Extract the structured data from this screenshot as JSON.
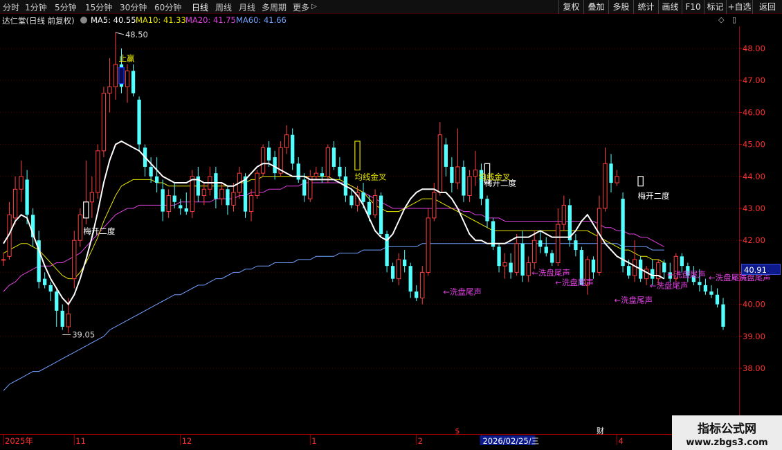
{
  "toolbar": {
    "periods": [
      "分时",
      "1分钟",
      "5分钟",
      "15分钟",
      "30分钟",
      "60分钟",
      "日线",
      "周线",
      "月线",
      "多周期",
      "更多"
    ],
    "active_period": "日线",
    "more_arrow": "▷",
    "buttons": [
      "复权",
      "叠加",
      "多股",
      "统计",
      "画线",
      "F10",
      "标记",
      "+自选",
      "返回"
    ]
  },
  "infobar": {
    "stock": "达仁堂(日线 前复权)",
    "ma5": "MA5: 40.55",
    "ma10": "MA10: 41.33",
    "ma20": "MA20: 41.75",
    "ma60": "MA60: 41.66",
    "ma5_color": "#ffffff",
    "ma10_color": "#e6e600",
    "ma20_color": "#e040e0",
    "ma60_color": "#70a0ff"
  },
  "price_box": "40.91",
  "watermark": {
    "title": "指标公式网",
    "url": "www.zbgs3.com"
  },
  "chart_data": {
    "type": "candlestick",
    "ylim": [
      37.0,
      49.0
    ],
    "yticks": [
      "48.00",
      "47.00",
      "46.00",
      "45.00",
      "44.00",
      "43.00",
      "42.00",
      "41.00",
      "40.00",
      "39.00",
      "38.00"
    ],
    "xlabels": [
      {
        "label": "2025年",
        "i": 0
      },
      {
        "label": "11",
        "i": 12
      },
      {
        "label": "12",
        "i": 30
      },
      {
        "label": "1",
        "i": 52
      },
      {
        "label": "2",
        "i": 70
      },
      {
        "label": "2026/02/25/三",
        "i": 81
      },
      {
        "label": "4",
        "i": 104
      }
    ],
    "markers": [
      {
        "label": "$",
        "i": 77,
        "color": "#ff3030"
      },
      {
        "label": "财",
        "i": 101,
        "color": "#ffffff"
      }
    ],
    "up_color": "#ff4040",
    "down_color": "#54ffff",
    "candles": [
      [
        41.4,
        41.6,
        41.2,
        41.4
      ],
      [
        41.5,
        43.2,
        41.4,
        42.8
      ],
      [
        42.7,
        44.0,
        42.5,
        43.6
      ],
      [
        43.6,
        44.5,
        43.2,
        44.0
      ],
      [
        43.9,
        44.2,
        42.5,
        42.8
      ],
      [
        42.8,
        43.0,
        41.8,
        42.1
      ],
      [
        42.0,
        42.3,
        40.5,
        40.7
      ],
      [
        40.8,
        41.0,
        40.5,
        40.6
      ],
      [
        40.6,
        40.7,
        40.1,
        40.4
      ],
      [
        40.4,
        40.5,
        39.3,
        39.8
      ],
      [
        39.8,
        40.0,
        39.2,
        39.3
      ],
      [
        39.3,
        40.2,
        39.1,
        39.7
      ],
      [
        40.8,
        42.3,
        40.5,
        42.0
      ],
      [
        42.0,
        43.0,
        41.8,
        42.8
      ],
      [
        42.8,
        44.5,
        42.5,
        43.2
      ],
      [
        43.2,
        44.0,
        42.7,
        43.5
      ],
      [
        43.5,
        45.0,
        43.3,
        44.8
      ],
      [
        44.8,
        46.8,
        44.6,
        46.6
      ],
      [
        46.6,
        47.7,
        46.0,
        46.8
      ],
      [
        46.8,
        48.5,
        46.4,
        47.5
      ],
      [
        47.5,
        48.0,
        46.6,
        46.8
      ],
      [
        46.8,
        47.5,
        46.3,
        47.3
      ],
      [
        47.3,
        47.5,
        46.5,
        46.6
      ],
      [
        46.4,
        46.5,
        44.8,
        45.0
      ],
      [
        44.9,
        45.0,
        44.0,
        44.3
      ],
      [
        44.3,
        44.6,
        43.8,
        44.0
      ],
      [
        44.0,
        44.6,
        43.5,
        43.8
      ],
      [
        43.6,
        43.9,
        42.6,
        42.9
      ],
      [
        42.9,
        43.6,
        42.7,
        43.4
      ],
      [
        43.4,
        43.8,
        43.0,
        43.2
      ],
      [
        43.1,
        43.3,
        42.8,
        43.0
      ],
      [
        43.0,
        43.5,
        42.8,
        42.9
      ],
      [
        42.9,
        44.2,
        42.7,
        44.0
      ],
      [
        44.0,
        44.3,
        43.2,
        43.4
      ],
      [
        43.4,
        43.8,
        43.1,
        43.6
      ],
      [
        43.6,
        44.3,
        43.4,
        44.0
      ],
      [
        44.1,
        44.3,
        43.0,
        43.3
      ],
      [
        43.3,
        43.8,
        43.1,
        43.6
      ],
      [
        43.6,
        43.7,
        42.8,
        43.1
      ],
      [
        43.1,
        43.8,
        42.9,
        43.5
      ],
      [
        43.5,
        44.3,
        43.3,
        44.1
      ],
      [
        44.0,
        44.1,
        42.7,
        42.9
      ],
      [
        42.9,
        43.6,
        42.6,
        43.4
      ],
      [
        43.4,
        44.2,
        43.3,
        44.1
      ],
      [
        44.1,
        45.0,
        44.0,
        44.9
      ],
      [
        44.9,
        45.1,
        44.3,
        44.5
      ],
      [
        44.6,
        44.8,
        43.9,
        44.1
      ],
      [
        44.1,
        45.1,
        44.0,
        44.9
      ],
      [
        44.9,
        45.6,
        44.7,
        45.3
      ],
      [
        45.3,
        45.5,
        44.2,
        44.4
      ],
      [
        44.4,
        44.6,
        43.8,
        43.9
      ],
      [
        43.9,
        44.1,
        43.2,
        43.4
      ],
      [
        43.3,
        44.2,
        43.2,
        44.0
      ],
      [
        44.0,
        44.3,
        43.9,
        44.1
      ],
      [
        44.1,
        44.3,
        43.8,
        44.0
      ],
      [
        44.0,
        45.0,
        43.8,
        44.9
      ],
      [
        44.9,
        45.1,
        44.2,
        44.3
      ],
      [
        44.3,
        44.6,
        43.9,
        44.0
      ],
      [
        44.0,
        44.3,
        43.2,
        43.4
      ],
      [
        43.4,
        43.6,
        43.0,
        43.1
      ],
      [
        43.1,
        43.7,
        42.9,
        43.5
      ],
      [
        43.5,
        43.8,
        43.0,
        43.2
      ],
      [
        43.2,
        43.4,
        42.6,
        42.8
      ],
      [
        42.8,
        43.6,
        42.7,
        43.4
      ],
      [
        43.4,
        43.5,
        42.1,
        42.2
      ],
      [
        42.2,
        42.3,
        41.0,
        41.2
      ],
      [
        41.2,
        41.3,
        40.7,
        40.8
      ],
      [
        40.8,
        41.6,
        40.6,
        41.4
      ],
      [
        41.4,
        41.7,
        41.0,
        41.2
      ],
      [
        41.2,
        41.3,
        40.2,
        40.4
      ],
      [
        40.4,
        40.6,
        40.1,
        40.2
      ],
      [
        40.2,
        41.2,
        40.0,
        41.0
      ],
      [
        41.0,
        43.0,
        40.9,
        42.7
      ],
      [
        42.7,
        43.8,
        42.6,
        43.5
      ],
      [
        43.5,
        45.7,
        43.4,
        45.3
      ],
      [
        45.0,
        45.2,
        44.0,
        44.3
      ],
      [
        44.3,
        44.6,
        43.5,
        43.8
      ],
      [
        43.8,
        45.5,
        43.6,
        44.3
      ],
      [
        44.3,
        44.5,
        43.2,
        43.4
      ],
      [
        43.4,
        44.2,
        43.2,
        44.0
      ],
      [
        44.0,
        44.8,
        43.7,
        44.2
      ],
      [
        44.2,
        44.4,
        43.1,
        43.3
      ],
      [
        43.3,
        43.4,
        42.4,
        42.6
      ],
      [
        42.6,
        42.7,
        41.7,
        41.8
      ],
      [
        41.8,
        41.9,
        41.0,
        41.2
      ],
      [
        41.2,
        41.6,
        40.8,
        41.3
      ],
      [
        41.3,
        41.6,
        40.8,
        41.0
      ],
      [
        41.0,
        42.2,
        40.9,
        41.9
      ],
      [
        41.9,
        42.3,
        40.7,
        40.9
      ],
      [
        40.9,
        41.5,
        40.7,
        41.3
      ],
      [
        41.3,
        42.3,
        41.1,
        42.0
      ],
      [
        42.0,
        42.3,
        41.6,
        41.8
      ],
      [
        41.8,
        42.1,
        41.5,
        41.6
      ],
      [
        41.6,
        41.7,
        41.2,
        41.3
      ],
      [
        41.3,
        43.0,
        41.2,
        42.5
      ],
      [
        42.5,
        43.4,
        42.3,
        43.1
      ],
      [
        43.1,
        43.3,
        41.8,
        42.0
      ],
      [
        42.0,
        42.2,
        41.5,
        41.7
      ],
      [
        41.7,
        41.8,
        40.6,
        40.6
      ],
      [
        40.6,
        41.5,
        40.3,
        41.4
      ],
      [
        41.4,
        41.5,
        40.8,
        41.0
      ],
      [
        41.0,
        43.4,
        40.9,
        43.0
      ],
      [
        43.0,
        44.9,
        42.9,
        44.4
      ],
      [
        44.4,
        44.7,
        43.5,
        43.8
      ],
      [
        43.8,
        44.2,
        43.7,
        44.0
      ],
      [
        43.3,
        43.5,
        41.0,
        41.2
      ],
      [
        41.2,
        41.4,
        40.8,
        40.9
      ],
      [
        40.9,
        42.0,
        40.7,
        41.4
      ],
      [
        41.4,
        41.5,
        40.7,
        40.8
      ],
      [
        40.8,
        41.2,
        40.6,
        41.1
      ],
      [
        41.1,
        41.4,
        40.6,
        40.8
      ],
      [
        40.8,
        41.4,
        40.6,
        41.3
      ],
      [
        41.3,
        41.4,
        40.8,
        41.0
      ],
      [
        41.0,
        41.3,
        40.7,
        40.8
      ],
      [
        40.8,
        41.6,
        40.7,
        41.5
      ],
      [
        41.5,
        41.6,
        41.0,
        41.2
      ],
      [
        41.2,
        41.3,
        40.7,
        40.9
      ],
      [
        40.9,
        41.2,
        40.6,
        40.7
      ],
      [
        40.7,
        41.1,
        40.4,
        40.6
      ],
      [
        40.6,
        40.8,
        40.3,
        40.4
      ],
      [
        40.4,
        40.6,
        40.2,
        40.3
      ],
      [
        40.3,
        40.5,
        39.9,
        40.0
      ],
      [
        40.0,
        40.2,
        39.2,
        39.3
      ]
    ],
    "ma5": [
      41.9,
      42.2,
      42.6,
      42.8,
      42.7,
      42.2,
      41.7,
      41.2,
      40.8,
      40.5,
      40.2,
      40.0,
      40.3,
      40.8,
      41.4,
      42.1,
      42.9,
      43.8,
      44.5,
      45.0,
      45.1,
      45.0,
      44.9,
      44.8,
      44.6,
      44.4,
      44.2,
      44.0,
      43.9,
      43.8,
      43.8,
      43.8,
      43.9,
      43.9,
      43.8,
      43.8,
      43.8,
      43.8,
      43.7,
      43.7,
      43.8,
      43.9,
      44.1,
      44.3,
      44.4,
      44.4,
      44.3,
      44.2,
      44.1,
      44.0,
      44.0,
      44.0,
      43.9,
      43.9,
      43.9,
      43.9,
      43.9,
      43.8,
      43.7,
      43.6,
      43.4,
      43.1,
      42.7,
      42.3,
      42.1,
      42.0,
      42.2,
      42.6,
      43.0,
      43.3,
      43.5,
      43.6,
      43.6,
      43.6,
      43.5,
      43.5,
      43.3,
      43.0,
      42.6,
      42.2,
      42.0,
      42.0,
      41.9,
      41.9,
      41.9,
      41.9,
      42.0,
      42.1,
      42.1,
      42.1,
      42.2,
      42.3,
      42.2,
      42.1,
      42.1,
      42.1,
      42.1,
      42.3,
      42.6,
      42.8,
      42.5,
      42.2,
      41.9,
      41.7,
      41.5,
      41.4,
      41.3,
      41.2,
      41.1,
      41.0,
      40.9,
      40.9,
      40.8
    ],
    "ma10": [
      41.6,
      41.7,
      41.8,
      41.9,
      41.9,
      41.8,
      41.7,
      41.5,
      41.3,
      41.1,
      40.9,
      40.8,
      40.8,
      41.0,
      41.3,
      41.7,
      42.1,
      42.6,
      43.0,
      43.4,
      43.7,
      43.8,
      43.9,
      43.9,
      43.9,
      43.9,
      43.8,
      43.8,
      43.7,
      43.7,
      43.7,
      43.7,
      43.7,
      43.7,
      43.7,
      43.7,
      43.7,
      43.7,
      43.7,
      43.7,
      43.8,
      43.8,
      43.9,
      43.9,
      44.0,
      44.0,
      44.0,
      44.0,
      44.0,
      44.0,
      44.0,
      44.0,
      44.0,
      44.0,
      44.0,
      44.0,
      43.9,
      43.9,
      43.8,
      43.7,
      43.6,
      43.5,
      43.3,
      43.1,
      43.0,
      42.9,
      42.9,
      42.9,
      43.0,
      43.1,
      43.2,
      43.3,
      43.3,
      43.3,
      43.2,
      43.1,
      43.0,
      42.9,
      42.8,
      42.7,
      42.6,
      42.5,
      42.4,
      42.3,
      42.3,
      42.3,
      42.3,
      42.3,
      42.3,
      42.3,
      42.3,
      42.3,
      42.3,
      42.3,
      42.3,
      42.3,
      42.3,
      42.3,
      42.3,
      42.3,
      42.2,
      42.1,
      42.0,
      41.9,
      41.8,
      41.7,
      41.7,
      41.6,
      41.5,
      41.5,
      41.4,
      41.4,
      41.3
    ],
    "ma20": [
      40.4,
      40.6,
      40.7,
      40.9,
      41.0,
      41.1,
      41.2,
      41.2,
      41.2,
      41.3,
      41.3,
      41.4,
      41.5,
      41.6,
      41.8,
      42.0,
      42.2,
      42.4,
      42.6,
      42.8,
      42.9,
      43.0,
      43.0,
      43.1,
      43.1,
      43.1,
      43.1,
      43.1,
      43.1,
      43.1,
      43.2,
      43.2,
      43.2,
      43.2,
      43.2,
      43.2,
      43.3,
      43.3,
      43.3,
      43.3,
      43.4,
      43.4,
      43.5,
      43.5,
      43.5,
      43.6,
      43.6,
      43.6,
      43.7,
      43.7,
      43.7,
      43.8,
      43.8,
      43.8,
      43.8,
      43.8,
      43.8,
      43.8,
      43.8,
      43.7,
      43.6,
      43.5,
      43.4,
      43.3,
      43.2,
      43.1,
      43.0,
      43.0,
      43.0,
      43.0,
      43.0,
      43.0,
      43.0,
      43.0,
      43.0,
      43.0,
      43.0,
      43.0,
      42.9,
      42.9,
      42.8,
      42.8,
      42.7,
      42.7,
      42.7,
      42.6,
      42.6,
      42.6,
      42.6,
      42.6,
      42.6,
      42.6,
      42.6,
      42.6,
      42.6,
      42.6,
      42.6,
      42.6,
      42.6,
      42.6,
      42.6,
      42.5,
      42.4,
      42.4,
      42.3,
      42.3,
      42.2,
      42.2,
      42.1,
      42.1,
      42.0,
      41.9,
      41.8
    ],
    "ma60": [
      37.3,
      37.5,
      37.6,
      37.7,
      37.8,
      37.9,
      37.9,
      38.0,
      38.1,
      38.2,
      38.3,
      38.4,
      38.5,
      38.6,
      38.7,
      38.8,
      38.9,
      39.0,
      39.2,
      39.3,
      39.4,
      39.5,
      39.6,
      39.7,
      39.8,
      39.9,
      40.0,
      40.1,
      40.2,
      40.3,
      40.3,
      40.4,
      40.5,
      40.6,
      40.6,
      40.7,
      40.8,
      40.8,
      40.9,
      41.0,
      41.0,
      41.1,
      41.1,
      41.2,
      41.2,
      41.2,
      41.3,
      41.3,
      41.3,
      41.3,
      41.4,
      41.4,
      41.4,
      41.5,
      41.5,
      41.5,
      41.5,
      41.6,
      41.6,
      41.6,
      41.6,
      41.7,
      41.7,
      41.7,
      41.7,
      41.8,
      41.8,
      41.8,
      41.8,
      41.8,
      41.8,
      41.9,
      41.9,
      41.9,
      41.9,
      41.9,
      41.9,
      41.9,
      41.9,
      41.9,
      41.9,
      41.9,
      41.9,
      41.9,
      41.9,
      41.9,
      41.9,
      41.9,
      41.9,
      41.9,
      41.9,
      41.9,
      41.9,
      41.9,
      41.9,
      41.9,
      41.9,
      41.9,
      41.9,
      41.9,
      41.9,
      41.9,
      41.9,
      41.9,
      41.9,
      41.8,
      41.8,
      41.8,
      41.8,
      41.8,
      41.7,
      41.7,
      41.7
    ],
    "high_label": {
      "text": "48.50",
      "i": 19,
      "value": 48.5
    },
    "low_label": {
      "text": "39.05",
      "i": 10,
      "value": 39.05
    },
    "annotations": [
      {
        "text": "止赢",
        "i": 20,
        "value": 47.6,
        "color": "#ffff00"
      },
      {
        "text": "梅开二度",
        "i": 14,
        "value": 42.2,
        "color": "#ffffff"
      },
      {
        "text": "梅开二度",
        "i": 108,
        "value": 43.3,
        "color": "#ffffff"
      },
      {
        "text": "梅开二度",
        "i": 82,
        "value": 43.7,
        "color": "#ffffff"
      },
      {
        "text": "均线金叉",
        "i": 60,
        "value": 43.9,
        "color": "#e6e600"
      },
      {
        "text": "均线金叉",
        "i": 81,
        "value": 43.9,
        "color": "#e6e600"
      },
      {
        "text": "←洗盘尾声",
        "i": 75,
        "value": 40.3,
        "color": "#e040e0"
      },
      {
        "text": "←洗盘尾声",
        "i": 90,
        "value": 40.9,
        "color": "#e040e0"
      },
      {
        "text": "←洗盘尾声",
        "i": 94,
        "value": 40.6,
        "color": "#e040e0"
      },
      {
        "text": "←洗盘尾声",
        "i": 104,
        "value": 40.05,
        "color": "#e040e0"
      },
      {
        "text": "←洗盘尾声",
        "i": 110,
        "value": 40.5,
        "color": "#e040e0"
      },
      {
        "text": "←洗盘尾声",
        "i": 113,
        "value": 40.85,
        "color": "#e040e0"
      },
      {
        "text": "←洗盘尾声",
        "i": 120,
        "value": 40.75,
        "color": "#e040e0"
      },
      {
        "text": "←洗盘尾声",
        "i": 124,
        "value": 40.75,
        "color": "#e040e0"
      }
    ],
    "box_markers": [
      {
        "i": 20,
        "open": 47.4,
        "close": 46.9,
        "color": "#1a3cff",
        "fill": "#0a0a50"
      },
      {
        "i": 14,
        "open": 43.2,
        "close": 42.7,
        "color": "#ffffff",
        "fill": "#000"
      },
      {
        "i": 60,
        "open": 45.1,
        "close": 44.2,
        "color": "#e6e600",
        "fill": "#000"
      },
      {
        "i": 82,
        "open": 44.4,
        "close": 43.8,
        "color": "#ffffff",
        "fill": "#000"
      },
      {
        "i": 108,
        "open": 44.0,
        "close": 43.7,
        "color": "#ffffff",
        "fill": "#000"
      }
    ]
  }
}
